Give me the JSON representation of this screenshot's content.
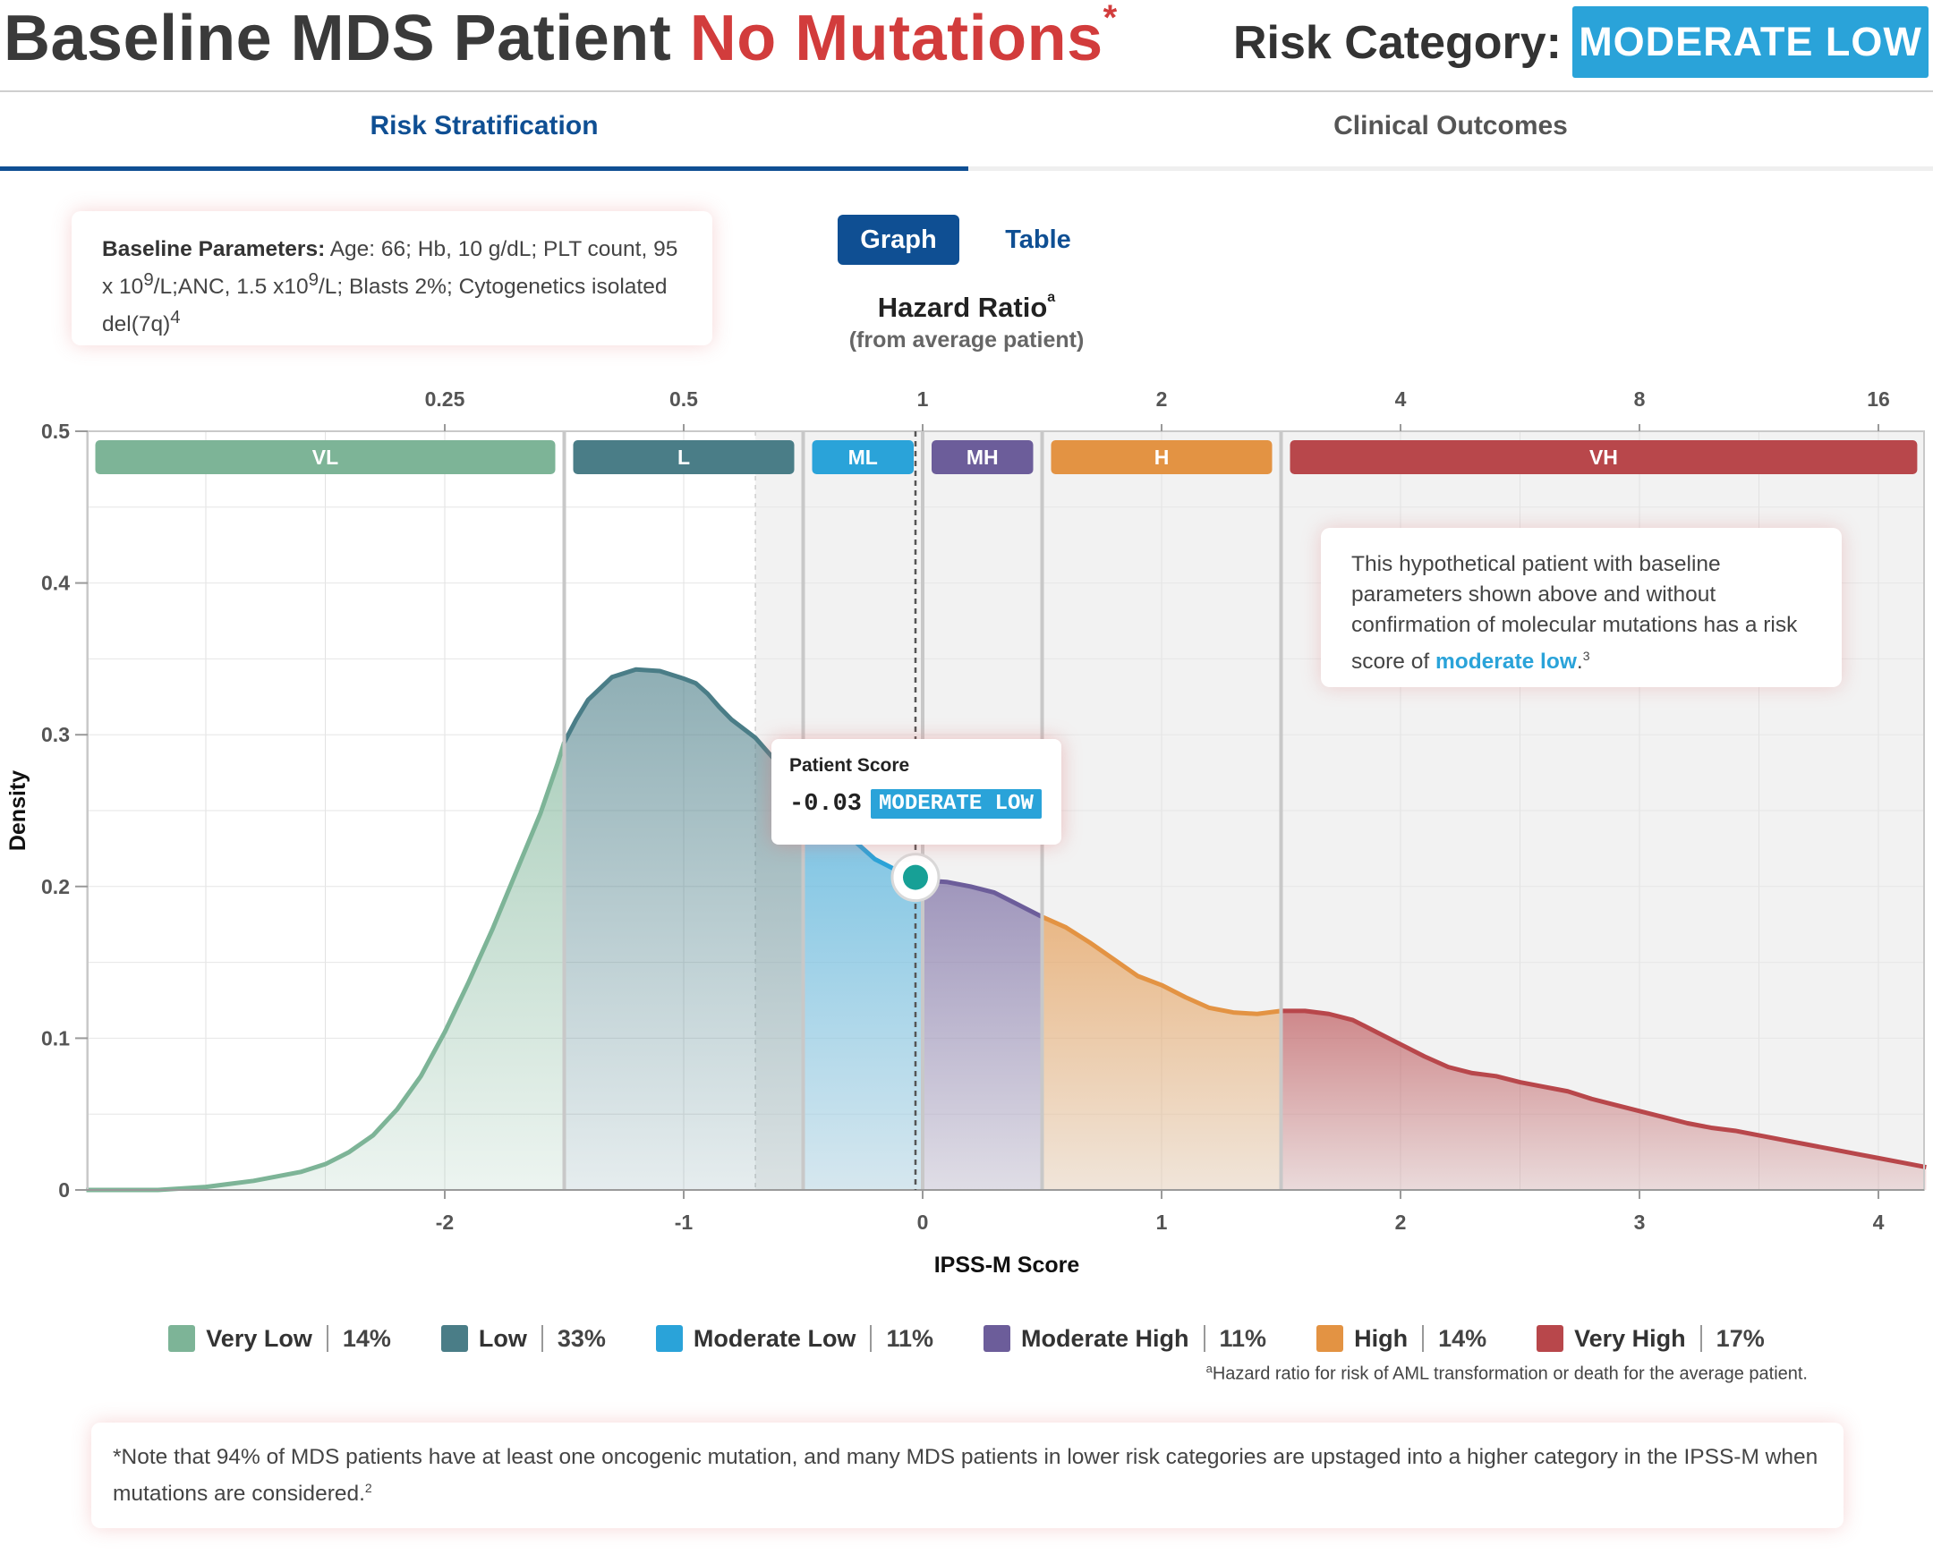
{
  "header": {
    "title_prefix": "Baseline MDS Patient ",
    "title_highlight": "No Mutations",
    "title_mark": "*",
    "risk_label": "Risk Category:",
    "risk_value": "MODERATE LOW"
  },
  "tabs": [
    {
      "label": "Risk Stratification",
      "active": true
    },
    {
      "label": "Clinical Outcomes",
      "active": false
    }
  ],
  "baseline": {
    "label": "Baseline Parameters:",
    "text_a": " Age: 66; Hb, 10 g/dL; PLT count, 95 x 10",
    "sup_a": "9",
    "text_b": "/L;ANC, 1.5 x10",
    "sup_b": "9",
    "text_c": "/L; Blasts 2%; Cytogenetics isolated del(7q)",
    "sup_c": "4"
  },
  "view_toggle": {
    "graph": "Graph",
    "table": "Table",
    "active": "graph"
  },
  "hazard_ratio": {
    "title": "Hazard Ratio",
    "title_sup": "a",
    "subtitle": "(from average patient)"
  },
  "note": {
    "text": "This hypothetical patient with baseline parameters shown above and without confirmation of molecular mutations has a risk score of ",
    "emphasis": "moderate low",
    "end": ".",
    "sup": "3"
  },
  "tooltip": {
    "title": "Patient Score",
    "score": "-0.03",
    "category": "MODERATE LOW"
  },
  "colors": {
    "very_low": "#7db497",
    "low": "#4a7d87",
    "moderate_low": "#2aa3d9",
    "moderate_high": "#6c5d9a",
    "high": "#e39343",
    "very_high": "#b8474b",
    "accent": "#0f4f93",
    "title_red": "#d23c3c"
  },
  "chart_data": {
    "type": "area",
    "xlabel": "IPSS-M Score",
    "ylabel": "Density",
    "top_axis_title": "Hazard Ratio",
    "xlim": [
      -3.5,
      4.2
    ],
    "ylim": [
      0,
      0.5
    ],
    "x_ticks": [
      -2,
      -1,
      0,
      1,
      2,
      3,
      4
    ],
    "x_tick_labels": [
      "-2",
      "-1",
      "0",
      "1",
      "2",
      "3",
      "4"
    ],
    "y_ticks": [
      0,
      0.1,
      0.2,
      0.3,
      0.4,
      0.5
    ],
    "y_tick_labels": [
      "0",
      "0.1",
      "0.2",
      "0.3",
      "0.4",
      "0.5"
    ],
    "top_ticks": [
      -2,
      -1,
      0,
      1,
      2,
      3,
      4
    ],
    "top_tick_labels": [
      "0.25",
      "0.5",
      "1",
      "2",
      "4",
      "8",
      "16"
    ],
    "patient_score": -0.03,
    "patient_density": 0.206,
    "bands": [
      {
        "label": "VL",
        "name": "Very Low",
        "from": -3.5,
        "to": -1.5,
        "color": "#7db497",
        "percent": "14%"
      },
      {
        "label": "L",
        "name": "Low",
        "from": -1.5,
        "to": -0.5,
        "color": "#4a7d87",
        "percent": "33%"
      },
      {
        "label": "ML",
        "name": "Moderate Low",
        "from": -0.5,
        "to": 0,
        "color": "#2aa3d9",
        "percent": "11%"
      },
      {
        "label": "MH",
        "name": "Moderate High",
        "from": 0,
        "to": 0.5,
        "color": "#6c5d9a",
        "percent": "11%"
      },
      {
        "label": "H",
        "name": "High",
        "from": 0.5,
        "to": 1.5,
        "color": "#e39343",
        "percent": "14%"
      },
      {
        "label": "VH",
        "name": "Very High",
        "from": 1.5,
        "to": 4.2,
        "color": "#b8474b",
        "percent": "17%"
      }
    ],
    "curve": [
      [
        -3.5,
        0.0
      ],
      [
        -3.2,
        0.0
      ],
      [
        -3.0,
        0.002
      ],
      [
        -2.8,
        0.006
      ],
      [
        -2.6,
        0.012
      ],
      [
        -2.5,
        0.017
      ],
      [
        -2.4,
        0.025
      ],
      [
        -2.3,
        0.036
      ],
      [
        -2.2,
        0.053
      ],
      [
        -2.1,
        0.075
      ],
      [
        -2.0,
        0.104
      ],
      [
        -1.9,
        0.137
      ],
      [
        -1.8,
        0.172
      ],
      [
        -1.7,
        0.21
      ],
      [
        -1.6,
        0.248
      ],
      [
        -1.53,
        0.28
      ],
      [
        -1.5,
        0.295
      ],
      [
        -1.45,
        0.31
      ],
      [
        -1.4,
        0.323
      ],
      [
        -1.3,
        0.338
      ],
      [
        -1.2,
        0.343
      ],
      [
        -1.1,
        0.342
      ],
      [
        -1.0,
        0.337
      ],
      [
        -0.95,
        0.334
      ],
      [
        -0.9,
        0.327
      ],
      [
        -0.85,
        0.318
      ],
      [
        -0.8,
        0.31
      ],
      [
        -0.7,
        0.298
      ],
      [
        -0.6,
        0.28
      ],
      [
        -0.5,
        0.265
      ],
      [
        -0.4,
        0.245
      ],
      [
        -0.3,
        0.232
      ],
      [
        -0.2,
        0.218
      ],
      [
        -0.1,
        0.21
      ],
      [
        -0.03,
        0.206
      ],
      [
        0.0,
        0.204
      ],
      [
        0.1,
        0.203
      ],
      [
        0.2,
        0.2
      ],
      [
        0.3,
        0.196
      ],
      [
        0.4,
        0.188
      ],
      [
        0.5,
        0.18
      ],
      [
        0.6,
        0.173
      ],
      [
        0.7,
        0.163
      ],
      [
        0.8,
        0.152
      ],
      [
        0.9,
        0.141
      ],
      [
        1.0,
        0.135
      ],
      [
        1.1,
        0.127
      ],
      [
        1.2,
        0.12
      ],
      [
        1.3,
        0.117
      ],
      [
        1.4,
        0.116
      ],
      [
        1.5,
        0.118
      ],
      [
        1.6,
        0.118
      ],
      [
        1.7,
        0.116
      ],
      [
        1.8,
        0.112
      ],
      [
        1.9,
        0.104
      ],
      [
        2.0,
        0.096
      ],
      [
        2.1,
        0.088
      ],
      [
        2.2,
        0.081
      ],
      [
        2.3,
        0.077
      ],
      [
        2.4,
        0.075
      ],
      [
        2.5,
        0.071
      ],
      [
        2.6,
        0.068
      ],
      [
        2.7,
        0.065
      ],
      [
        2.8,
        0.06
      ],
      [
        2.9,
        0.056
      ],
      [
        3.0,
        0.052
      ],
      [
        3.1,
        0.048
      ],
      [
        3.2,
        0.044
      ],
      [
        3.3,
        0.041
      ],
      [
        3.4,
        0.039
      ],
      [
        3.5,
        0.036
      ],
      [
        3.6,
        0.033
      ],
      [
        3.7,
        0.03
      ],
      [
        3.8,
        0.027
      ],
      [
        3.9,
        0.024
      ],
      [
        4.0,
        0.021
      ],
      [
        4.1,
        0.018
      ],
      [
        4.2,
        0.015
      ]
    ]
  },
  "footnote": {
    "sup": "a",
    "text": "Hazard ratio for risk of AML transformation or death for the average patient."
  },
  "bottom_note": {
    "text": "*Note that 94% of MDS patients have at least one oncogenic mutation, and many MDS patients in lower risk categories are upstaged into a higher category in the IPSS-M when mutations are considered.",
    "sup": "2"
  }
}
